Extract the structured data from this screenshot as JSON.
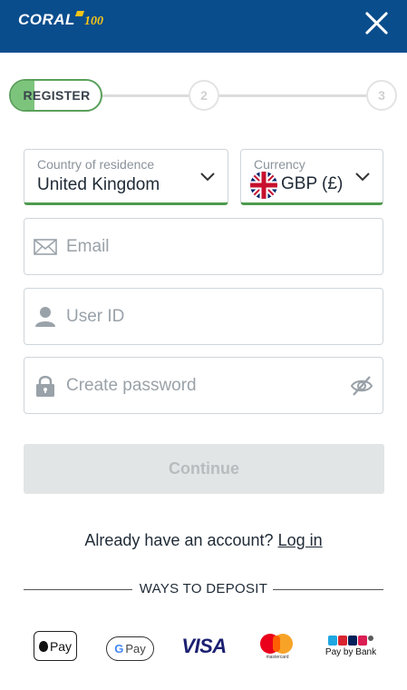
{
  "header": {
    "logo_text": "CORAL",
    "logo_badge": "100",
    "close_icon": "close-icon",
    "background": "#0a4d8c"
  },
  "stepper": {
    "active_label": "REGISTER",
    "step2": "2",
    "step3": "3",
    "active_color": "#5aa05a"
  },
  "country": {
    "caption": "Country of residence",
    "value": "United Kingdom",
    "icon": "chevron-down-icon"
  },
  "currency": {
    "caption": "Currency",
    "value": "GBP (£)",
    "flag_icon": "uk-flag-icon",
    "icon": "chevron-down-icon"
  },
  "fields": {
    "email_placeholder": "Email",
    "email_icon": "envelope-icon",
    "userid_placeholder": "User ID",
    "userid_icon": "user-icon",
    "password_placeholder": "Create password",
    "password_icon": "lock-icon",
    "password_toggle_icon": "eye-hidden-icon"
  },
  "continue_label": "Continue",
  "login": {
    "prompt": "Already have an account?",
    "link": "Log in"
  },
  "deposit": {
    "heading": "WAYS TO DEPOSIT",
    "methods": {
      "apple_pay": "Pay",
      "google_pay": "Pay",
      "visa": "VISA",
      "mastercard": "mastercard",
      "pay_by_bank": "Pay by Bank"
    }
  }
}
